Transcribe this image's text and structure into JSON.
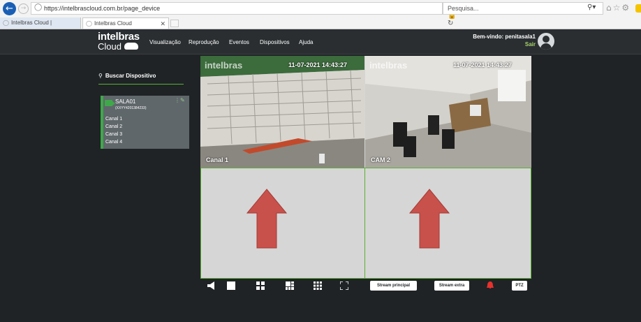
{
  "browser": {
    "url": "https://intelbrascloud.com.br/page_device",
    "search_placeholder": "Pesquisa...",
    "tabs": [
      {
        "label": "Intelbras Cloud |"
      },
      {
        "label": "Intelbras Cloud"
      }
    ]
  },
  "app": {
    "logo_line1": "intelbras",
    "logo_line2": "Cloud",
    "nav": [
      "Visualização",
      "Reprodução",
      "Eventos",
      "Dispositivos",
      "Ajuda"
    ],
    "welcome": "Bem-vindo: penitasala1",
    "logout": "Sair"
  },
  "sidebar": {
    "search_label": "Buscar Dispositivo",
    "device": {
      "name": "SALA01",
      "serial": "(XXYY4201384233)",
      "channels": [
        "Canal 1",
        "Canal 2",
        "Canal 3",
        "Canal 4"
      ]
    }
  },
  "video": {
    "cells": [
      {
        "watermark": "intelbras",
        "timestamp": "11-07-2021 14:43:27",
        "label": "Canal 1"
      },
      {
        "watermark": "intelbras",
        "timestamp": "11-07-2021 14:43:27",
        "label": "CAM 2"
      }
    ]
  },
  "toolbar": {
    "stream_main": "Stream principal",
    "stream_extra": "Stream extra",
    "ptz": "PTZ"
  },
  "colors": {
    "accent_green": "#5bb033",
    "arrow_red": "#c9514b",
    "alarm_red": "#e5322d"
  }
}
